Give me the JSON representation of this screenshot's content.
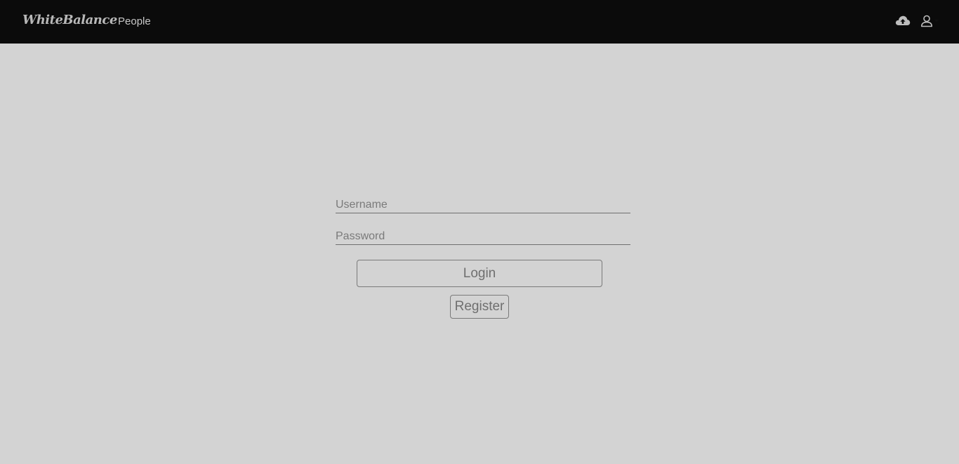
{
  "navbar": {
    "brand": "WhiteBalance",
    "links": [
      {
        "label": "People"
      }
    ],
    "icons": {
      "upload": "cloud-upload-icon",
      "user": "user-icon"
    },
    "background_color": "#0b0b0b"
  },
  "login_form": {
    "username": {
      "placeholder": "Username",
      "value": ""
    },
    "password": {
      "placeholder": "Password",
      "value": ""
    },
    "login_label": "Login",
    "register_label": "Register"
  },
  "page": {
    "background_color": "#d3d3d3"
  }
}
